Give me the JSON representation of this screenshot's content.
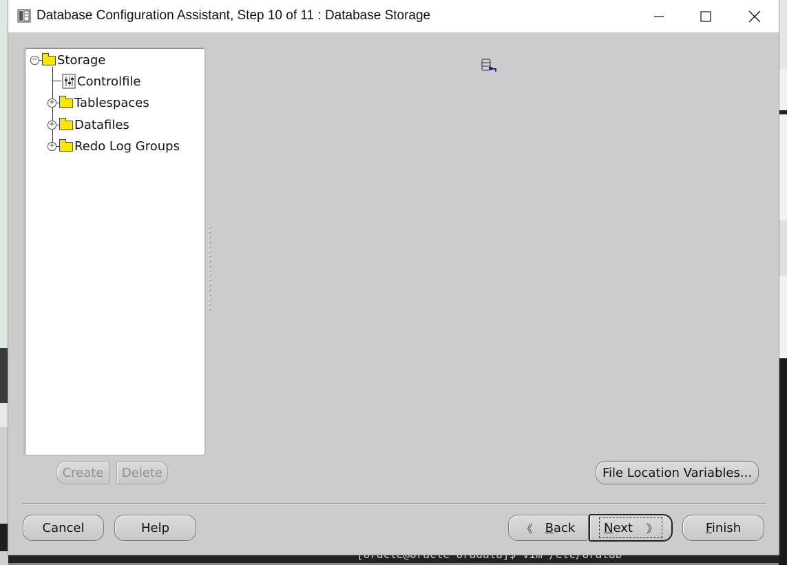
{
  "window": {
    "title": "Database Configuration Assistant, Step 10 of 11 : Database Storage"
  },
  "tree": {
    "root": "Storage",
    "items": [
      "Controlfile",
      "Tablespaces",
      "Datafiles",
      "Redo Log Groups"
    ]
  },
  "tree_buttons": {
    "create": "Create",
    "delete": "Delete"
  },
  "file_location_variables": "File Location Variables...",
  "nav": {
    "cancel": "Cancel",
    "help": "Help",
    "back_mnemonic": "B",
    "back_rest": "ack",
    "next_mnemonic": "N",
    "next_rest": "ext",
    "finish_mnemonic": "F",
    "finish_rest": "inish"
  },
  "background": {
    "terminal_text": "[oracle@oracle oradata]$ vim /etc/oratab"
  },
  "colors": {
    "window_bg": "#cccccc",
    "folder": "#f6e600",
    "titlebar": "#ffffff"
  }
}
